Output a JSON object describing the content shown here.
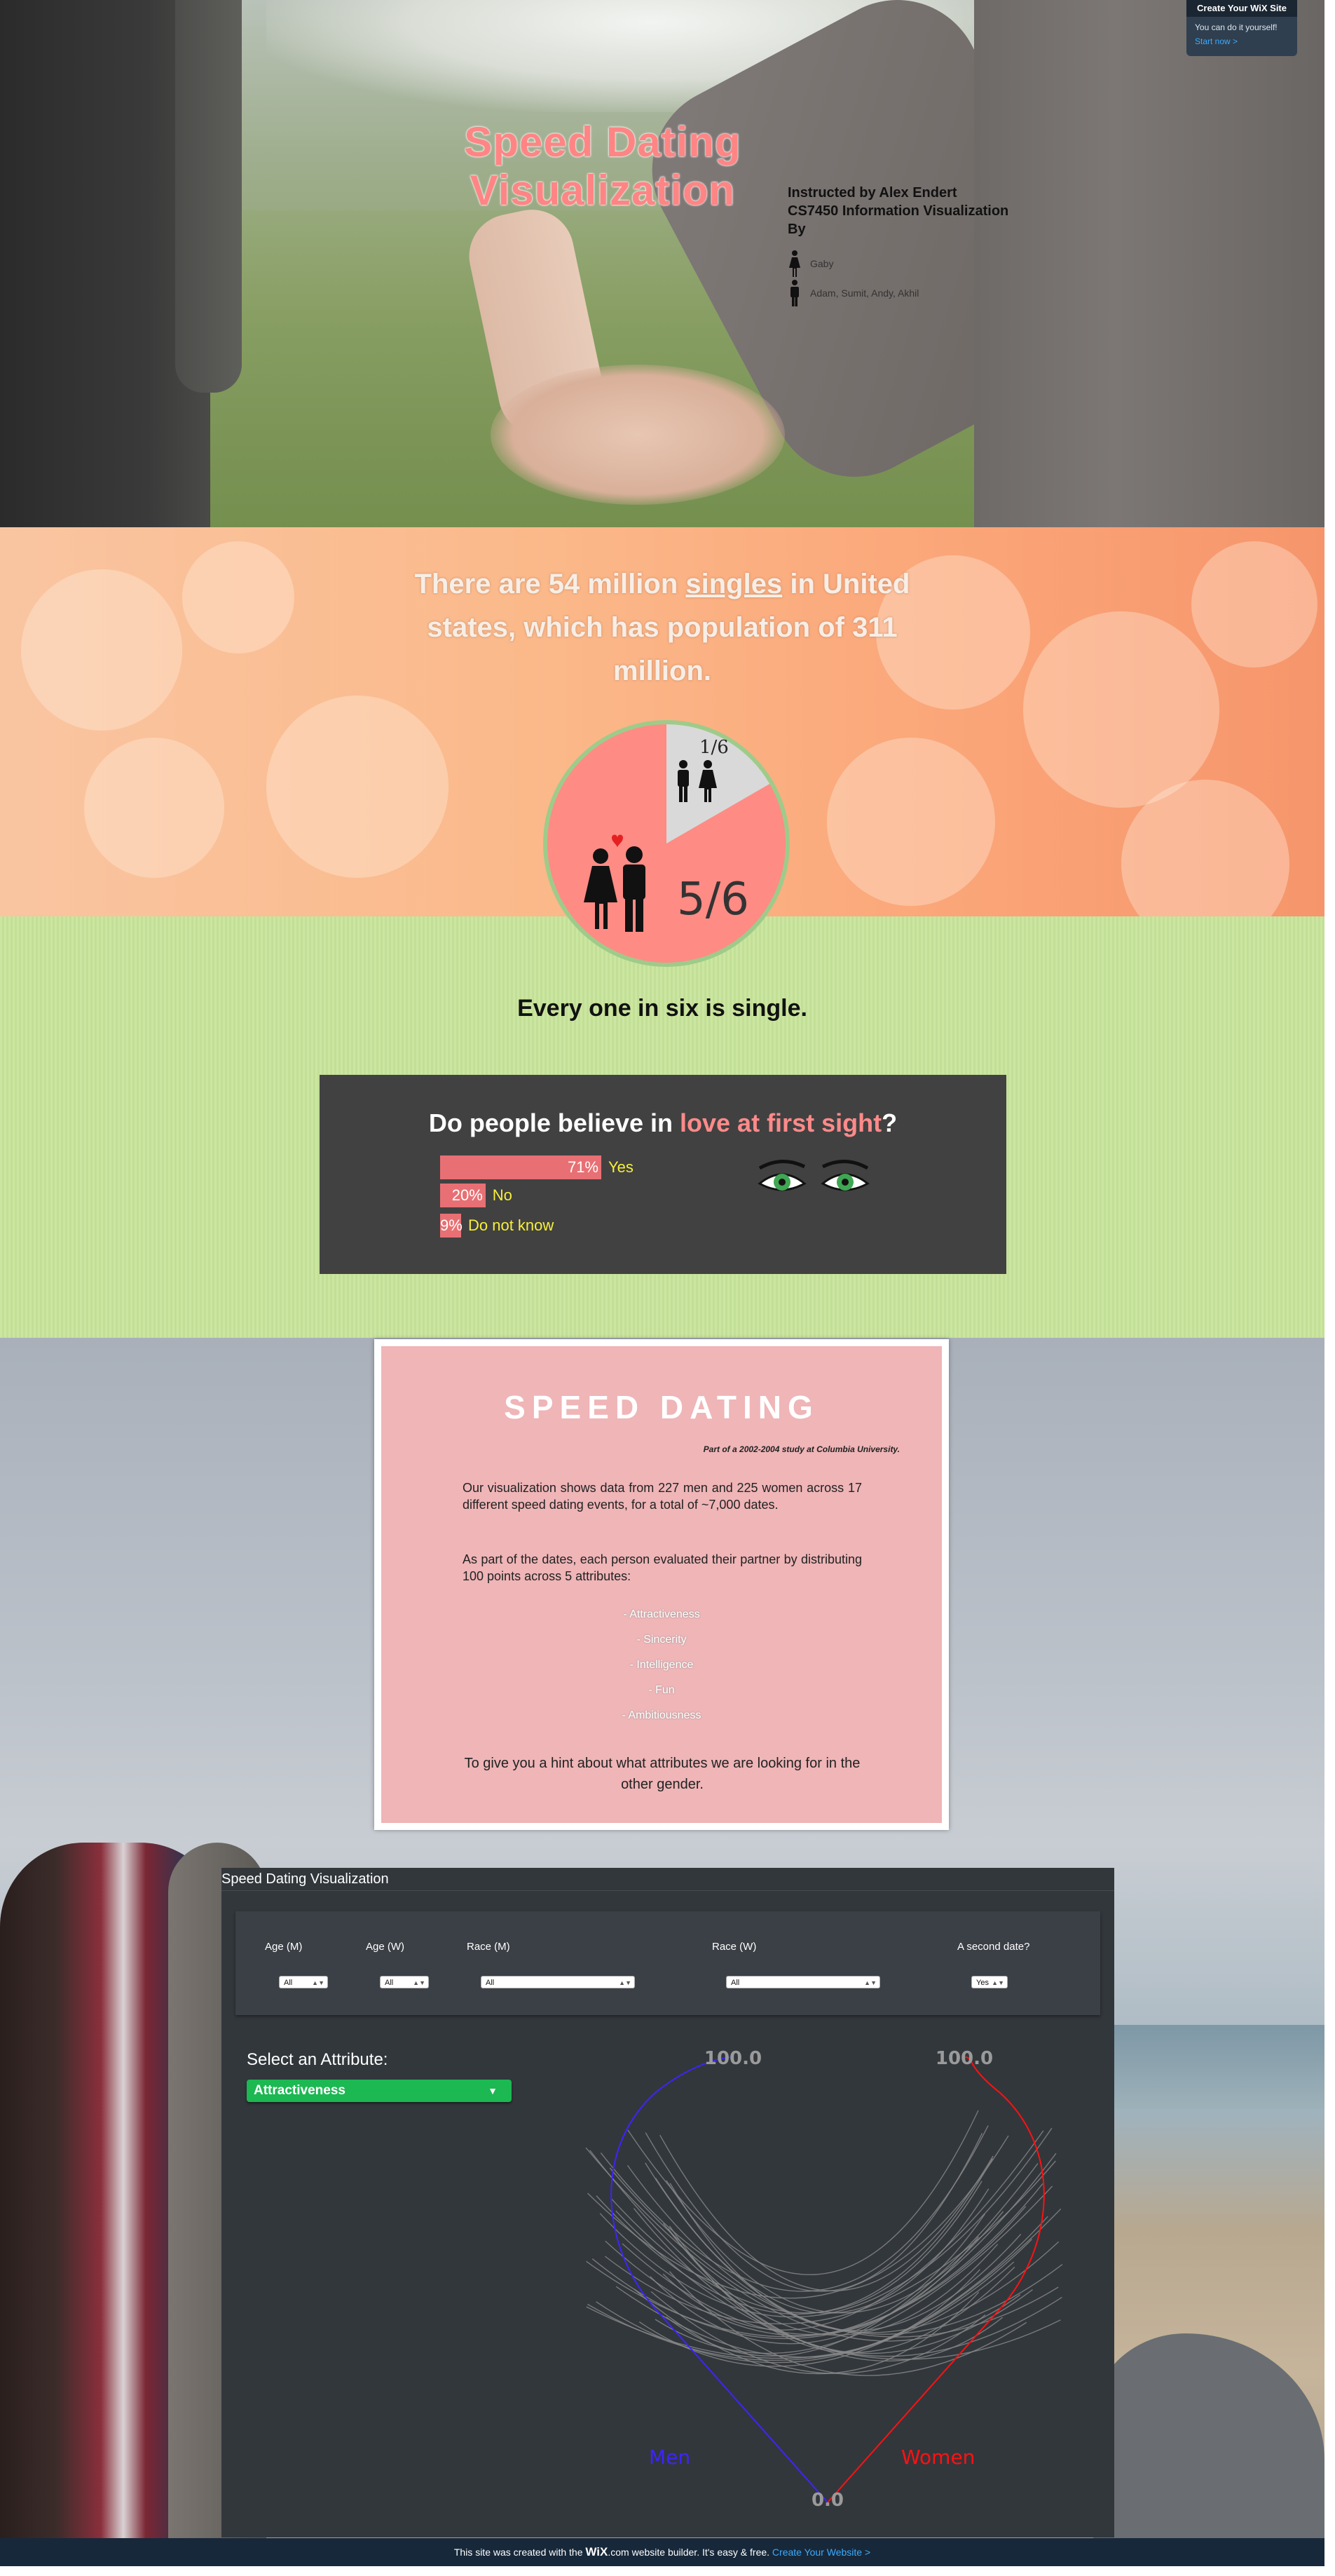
{
  "hero": {
    "title": "Speed Dating Visualization",
    "instructor": "Instructed by Alex Endert",
    "course": "CS7450  Information Visualization",
    "by": "By",
    "female_authors": "Gaby",
    "male_authors": "Adam, Sumit, Andy, Akhil"
  },
  "wix_banner": {
    "title": "Create Your WiX Site",
    "subtitle": "You can do it yourself!",
    "link": "Start now >"
  },
  "singles": {
    "text_before": "There are 54 million ",
    "text_underlined": "singles",
    "text_after": " in United states, which has population of 311 million.",
    "single_fraction": "1/6",
    "couple_fraction": "5/6",
    "caption": "Every one in six is single.",
    "colors": {
      "couples": "#ff8b85",
      "singles": "#d9d9d9"
    }
  },
  "love": {
    "title_before": "Do people believe in ",
    "title_highlight": "love at first sight",
    "title_after": "?",
    "bars": [
      {
        "percent": "71%",
        "label": "Yes",
        "value": 71
      },
      {
        "percent": "20%",
        "label": "No",
        "value": 20
      },
      {
        "percent": "9%",
        "label": "Do not know",
        "value": 9
      }
    ]
  },
  "speed_dating": {
    "title": "SPEED DATING",
    "subtitle": "Part of a 2002-2004 study at Columbia University.",
    "para1": "Our visualization shows data from 227 men and 225 women across 17 different speed dating events, for a total of ~7,000 dates.",
    "para2": "As part of the dates, each person evaluated their partner by distributing 100 points across 5 attributes:",
    "attributes": [
      "- Attractiveness",
      "- Sincerity",
      "- Intelligence",
      "- Fun",
      "- Ambitiousness"
    ],
    "hint": "To give you a hint about what attributes we are looking for in the other gender."
  },
  "vis": {
    "title": "Speed Dating Visualization",
    "filters": [
      {
        "label": "Age (M)",
        "value": "All"
      },
      {
        "label": "Age (W)",
        "value": "All"
      },
      {
        "label": "Race (M)",
        "value": "All"
      },
      {
        "label": "Race (W)",
        "value": "All"
      },
      {
        "label": "A second date?",
        "value": "Yes"
      }
    ],
    "select_label": "Select an Attribute:",
    "selected_attribute": "Attractiveness",
    "max_left": "100.0",
    "max_right": "100.0",
    "min_bottom": "0.0",
    "men_label": "Men",
    "women_label": "Women",
    "colors": {
      "men": "#3d24ff",
      "women": "#ff1111",
      "links": "#8a8a8a"
    }
  },
  "footer": {
    "text_before": "This site was created with the ",
    "brand": "WiX",
    "text_after": ".com website builder. It's easy & free.",
    "link": "Create Your Website >"
  }
}
